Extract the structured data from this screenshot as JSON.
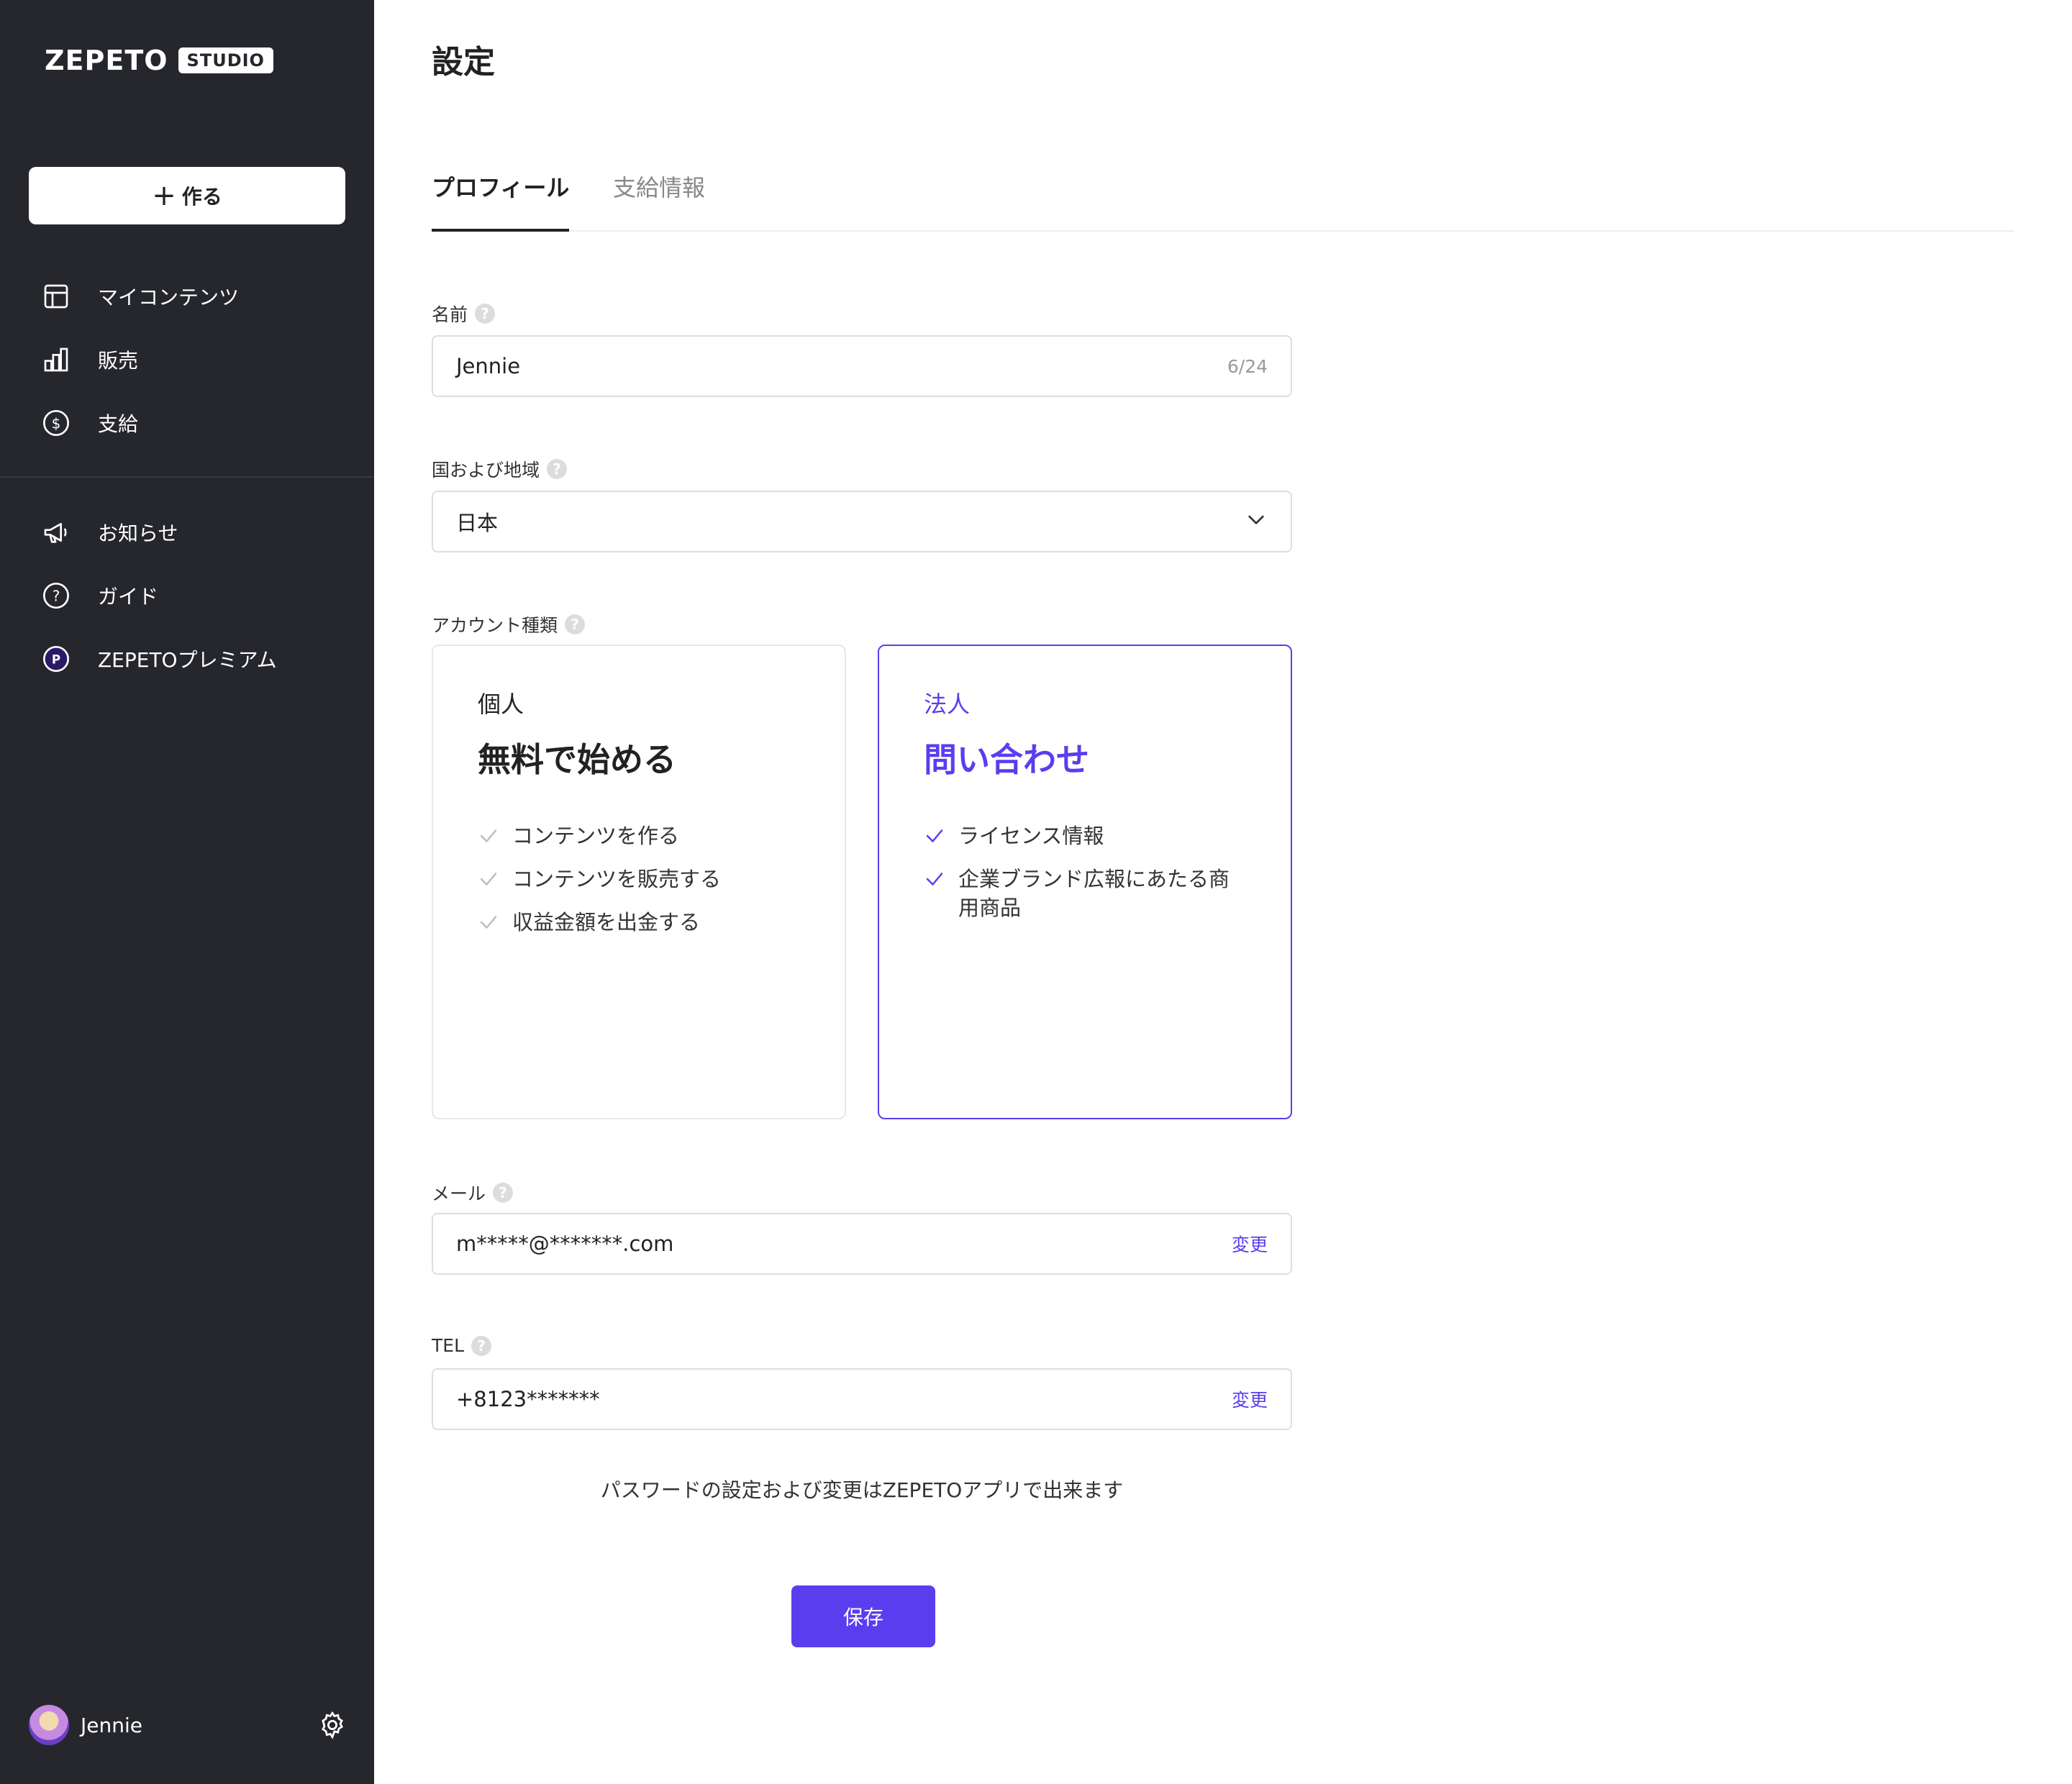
{
  "sidebar": {
    "logo_word": "ZEPETO",
    "logo_badge": "STUDIO",
    "create_label": "作る",
    "nav_primary": [
      {
        "label": "マイコンテンツ",
        "icon": "layout-icon"
      },
      {
        "label": "販売",
        "icon": "bar-chart-icon"
      },
      {
        "label": "支給",
        "icon": "dollar-circle-icon"
      }
    ],
    "nav_secondary": [
      {
        "label": "お知らせ",
        "icon": "megaphone-icon"
      },
      {
        "label": "ガイド",
        "icon": "question-circle-icon"
      },
      {
        "label": "ZEPETOプレミアム",
        "icon": "premium-icon"
      }
    ],
    "user_name": "Jennie"
  },
  "page": {
    "title": "設定",
    "tabs": [
      {
        "label": "プロフィール",
        "active": true
      },
      {
        "label": "支給情報",
        "active": false
      }
    ]
  },
  "form": {
    "name_label": "名前",
    "name_value": "Jennie",
    "name_counter": "6/24",
    "country_label": "国および地域",
    "country_value": "日本",
    "account_label": "アカウント種類",
    "account_cards": [
      {
        "type": "個人",
        "headline": "無料で始める",
        "features": [
          "コンテンツを作る",
          "コンテンツを販売する",
          "収益金額を出金する"
        ],
        "selected": false
      },
      {
        "type": "法人",
        "headline": "問い合わせ",
        "features": [
          "ライセンス情報",
          "企業ブランド広報にあたる商用商品"
        ],
        "selected": true
      }
    ],
    "email_label": "メール",
    "email_value": "m*****@*******.com",
    "email_change": "変更",
    "tel_label": "TEL",
    "tel_value": "+8123*******",
    "tel_change": "変更",
    "password_note": "パスワードの設定および変更はZEPETOアプリで出来ます",
    "save_label": "保存",
    "help_glyph": "?"
  },
  "colors": {
    "sidebar_bg": "#26272d",
    "accent": "#5b3df0"
  }
}
